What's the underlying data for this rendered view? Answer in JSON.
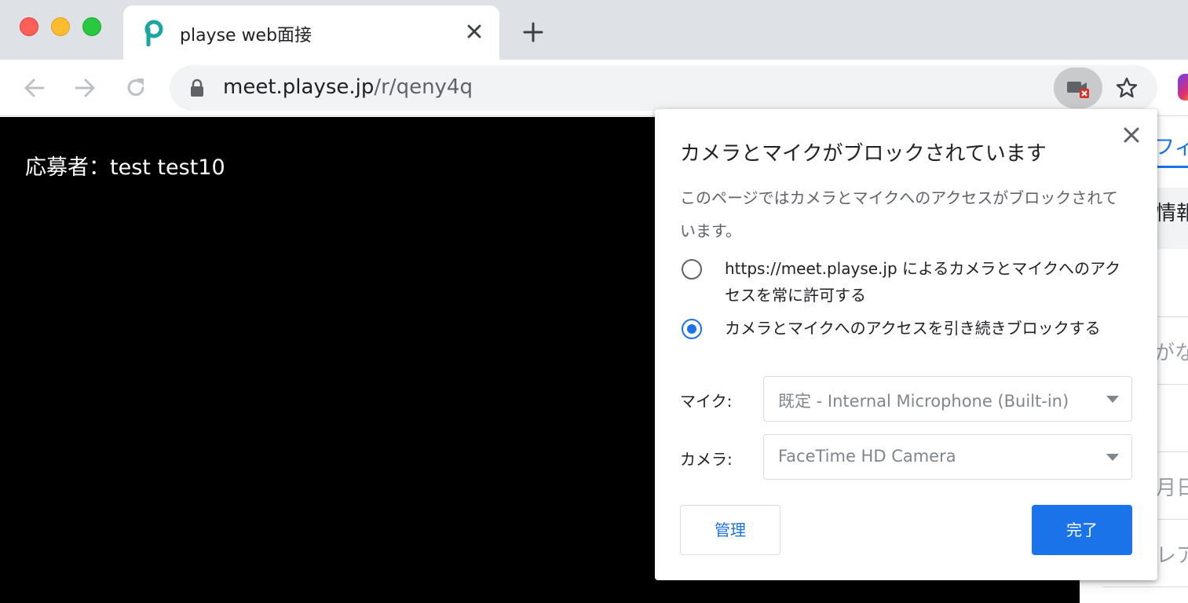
{
  "browser": {
    "tab": {
      "title": "playse web面接",
      "favicon": "playse-logo-icon"
    },
    "url": {
      "host": "meet.playse.jp",
      "path": "/r/qeny4q"
    }
  },
  "page": {
    "applicant_label": "応募者：test test10",
    "side_panel": {
      "items": [
        "フィ",
        "情報",
        "がな",
        "月日",
        "レア"
      ]
    }
  },
  "popup": {
    "title": "カメラとマイクがブロックされています",
    "description": "このページではカメラとマイクへのアクセスがブロックされています。",
    "options": [
      {
        "label": "https://meet.playse.jp によるカメラとマイクへのアクセスを常に許可する",
        "selected": false
      },
      {
        "label": "カメラとマイクへのアクセスを引き続きブロックする",
        "selected": true
      }
    ],
    "mic": {
      "label": "マイク:",
      "value": "既定 - Internal Microphone (Built-in)"
    },
    "camera": {
      "label": "カメラ:",
      "value": "FaceTime HD Camera"
    },
    "manage_label": "管理",
    "done_label": "完了"
  },
  "colors": {
    "accent": "#1a73e8",
    "favicon": "#1aa6a1",
    "blocked_badge": "#d93025"
  }
}
